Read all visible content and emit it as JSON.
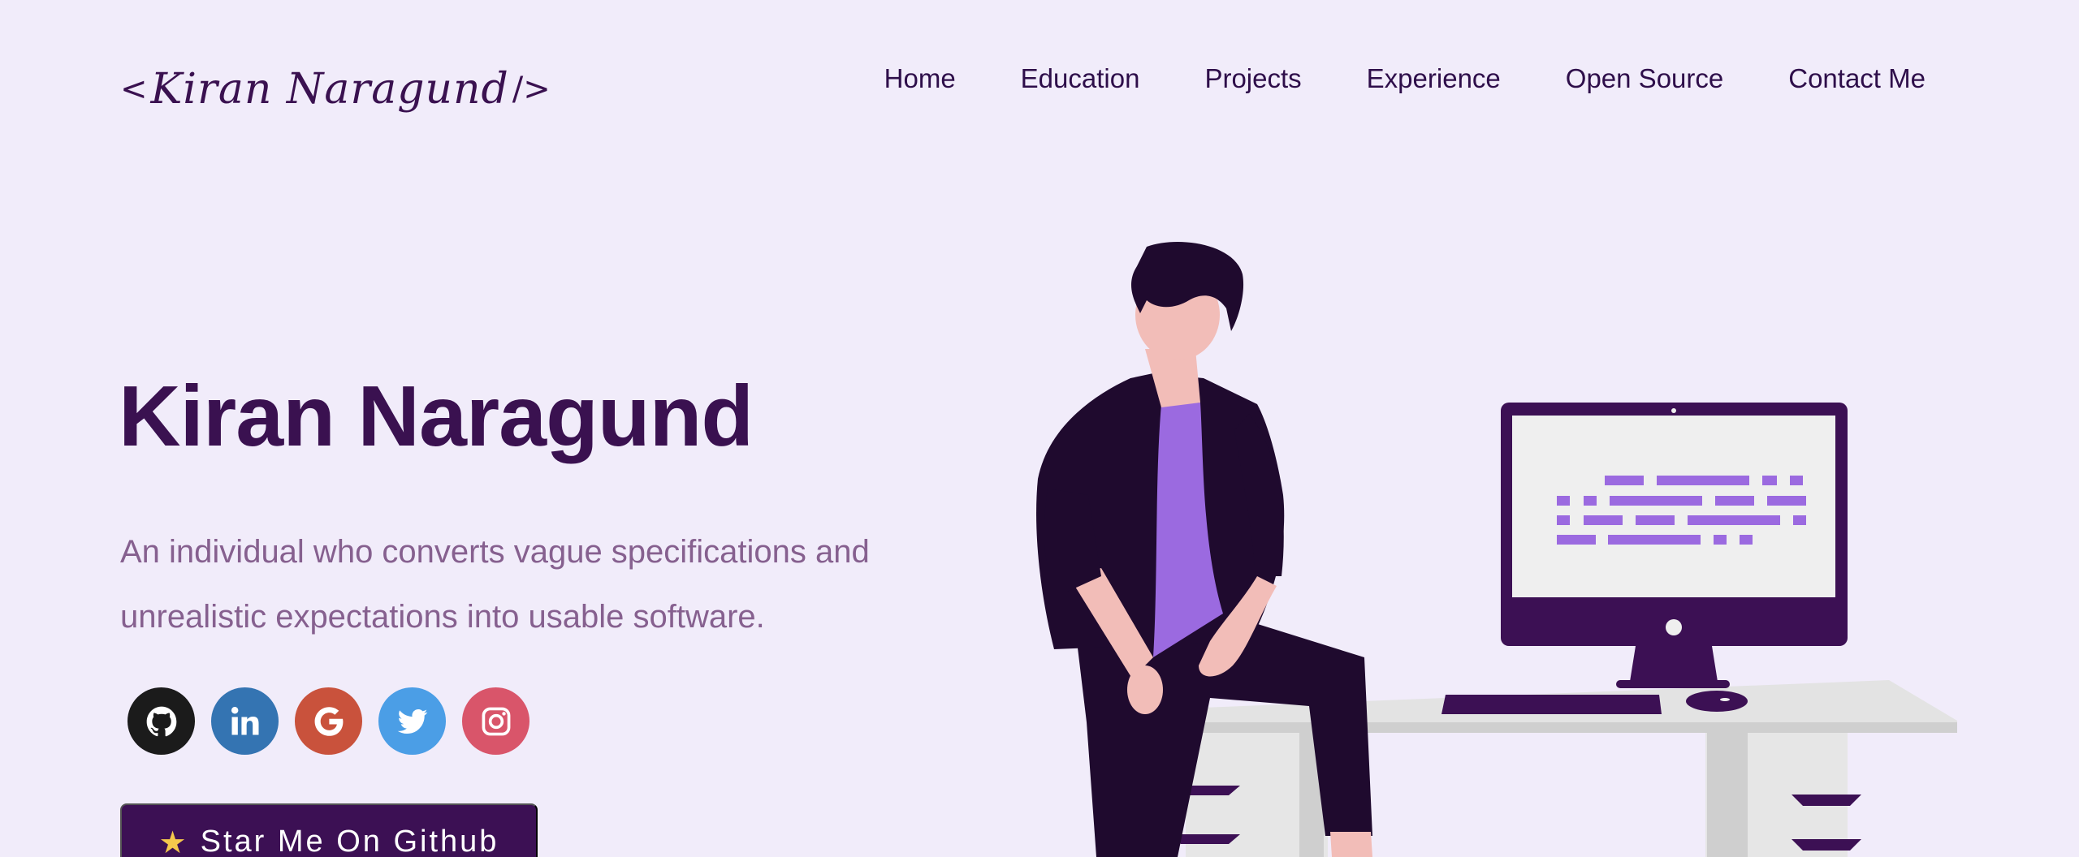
{
  "header": {
    "logo": {
      "open": "<",
      "signature": "Kiran Naragund",
      "close": "/>"
    },
    "nav": [
      {
        "label": "Home"
      },
      {
        "label": "Education"
      },
      {
        "label": "Projects"
      },
      {
        "label": "Experience"
      },
      {
        "label": "Open Source"
      },
      {
        "label": "Contact Me"
      }
    ]
  },
  "hero": {
    "title": "Kiran Naragund",
    "subtitle": "An individual who converts vague specifications and unrealistic expectations into usable software.",
    "socials": [
      {
        "icon": "github-icon",
        "color": "#1b1b1b"
      },
      {
        "icon": "linkedin-icon",
        "color": "#3474b2"
      },
      {
        "icon": "google-icon",
        "color": "#c9523c"
      },
      {
        "icon": "twitter-icon",
        "color": "#4b9ee6"
      },
      {
        "icon": "instagram-icon",
        "color": "#d9556a"
      }
    ],
    "star_button": {
      "icon": "star-icon",
      "label": "Star Me On Github"
    }
  },
  "colors": {
    "background": "#f1ecfa",
    "primary": "#3c1054",
    "accent": "#9b6ae0",
    "subtitle": "#86608f"
  }
}
